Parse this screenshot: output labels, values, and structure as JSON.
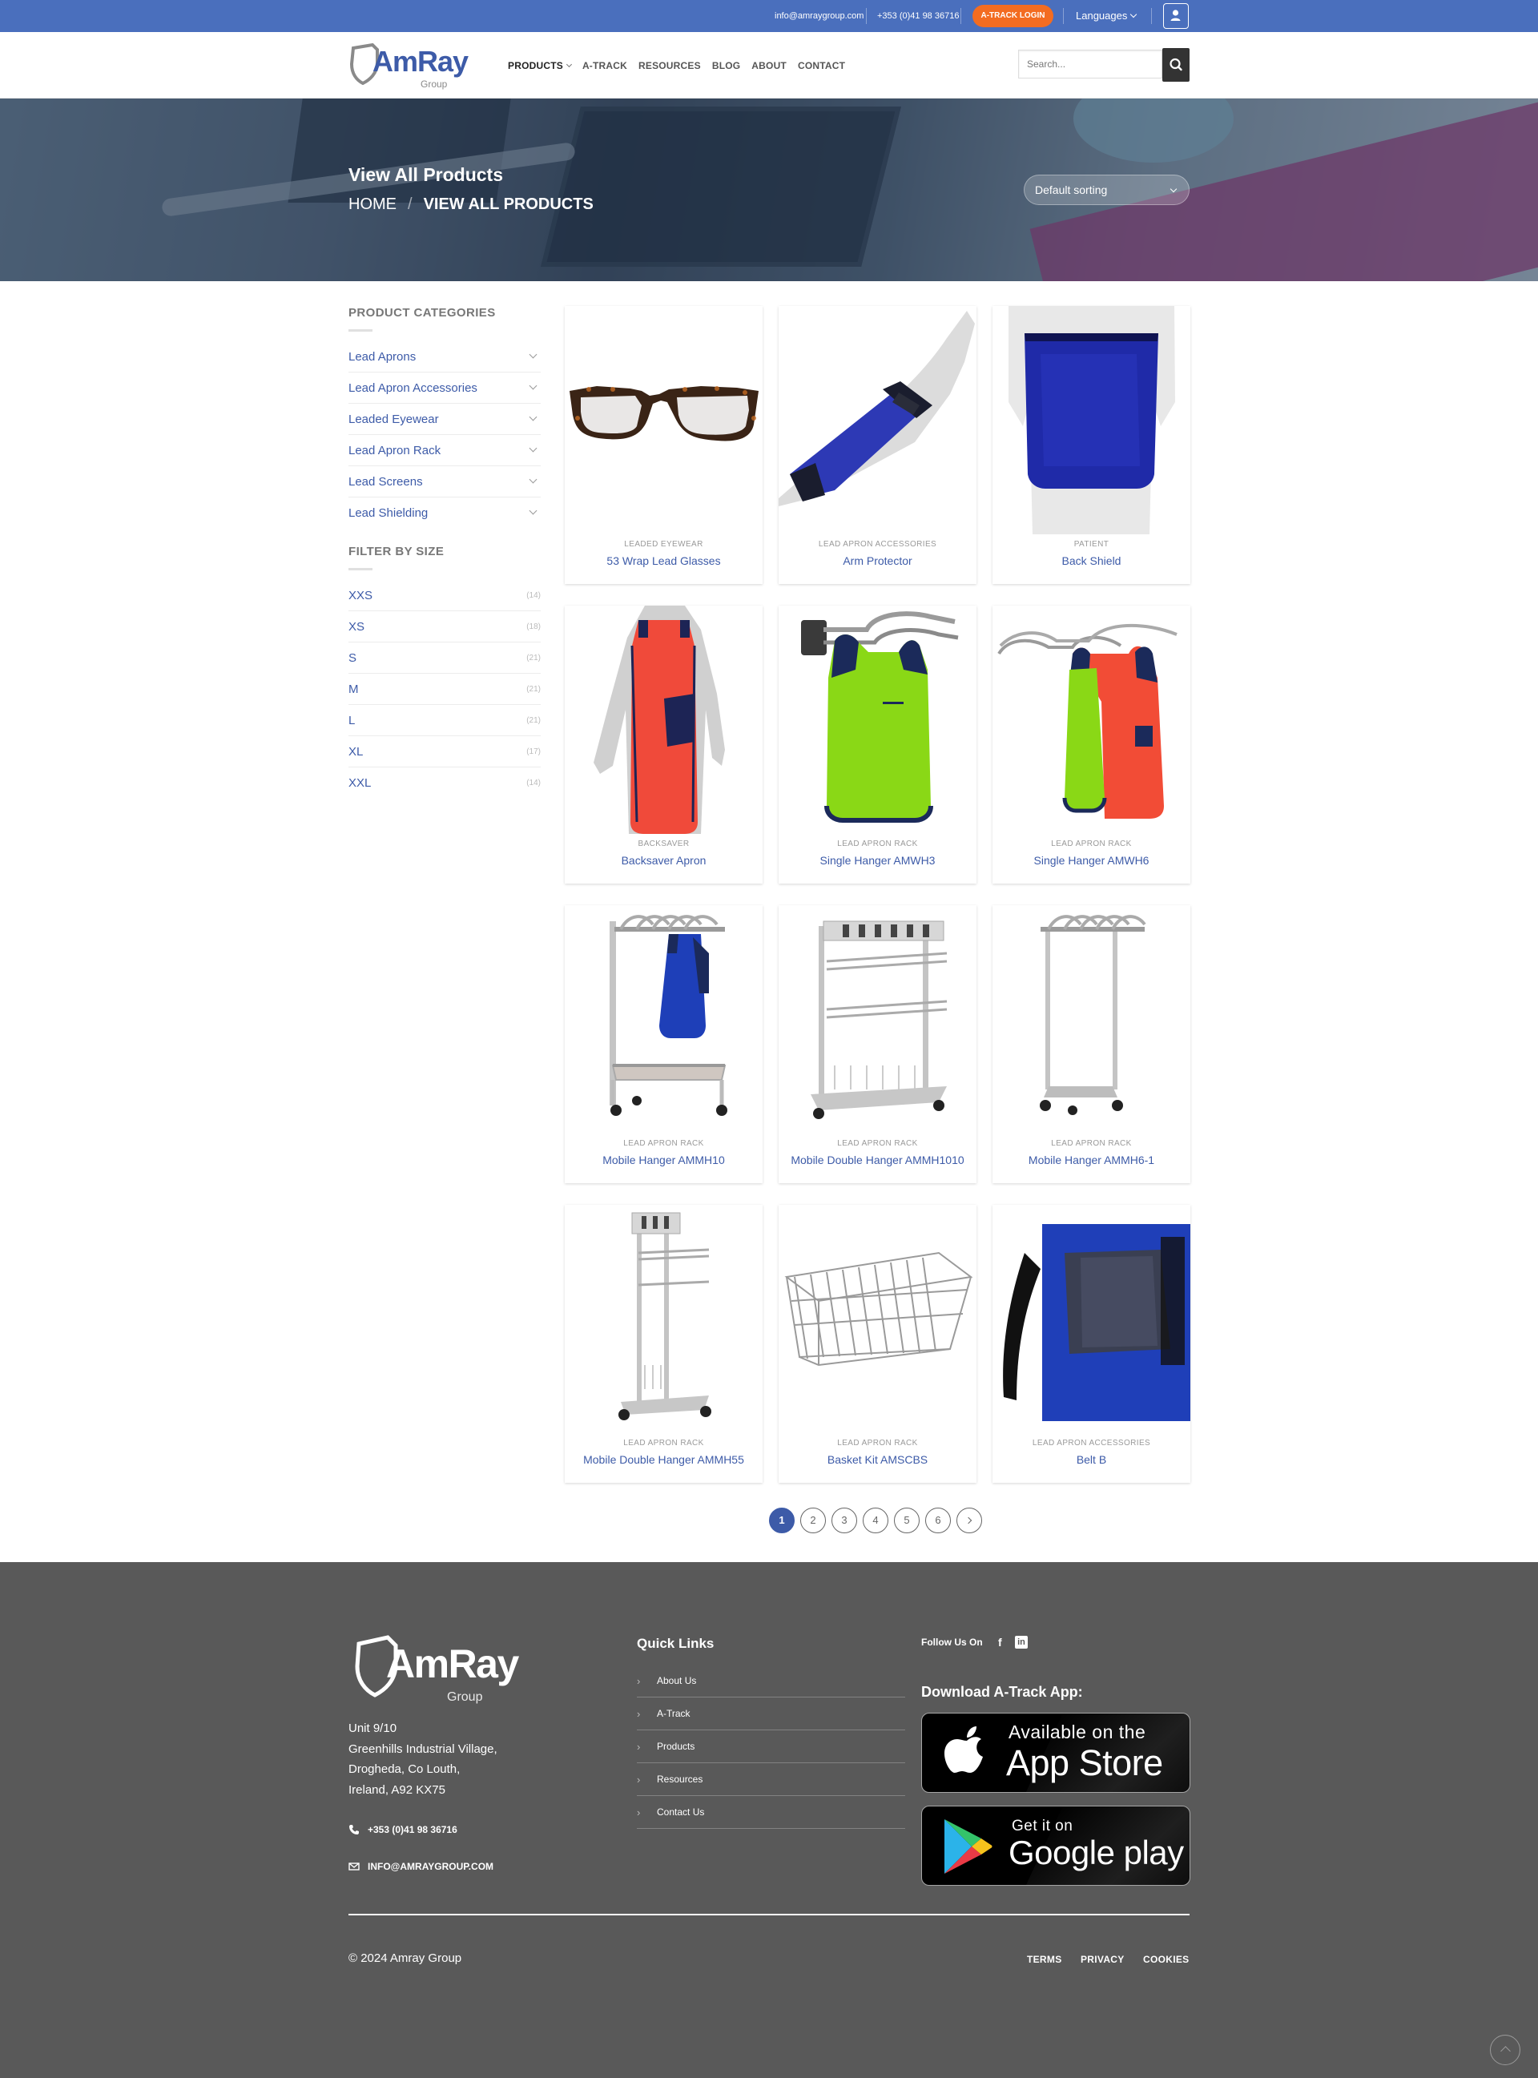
{
  "topbar": {
    "email": "info@amraygroup.com",
    "phone": "+353 (0)41 98 36716",
    "login_label": "A-TRACK LOGIN",
    "languages_label": "Languages",
    "color": "#4a6fbd",
    "login_color": "#f36c21"
  },
  "header": {
    "logo_brand": "AmRay",
    "logo_sub": "Group",
    "nav": [
      "PRODUCTS",
      "A-TRACK",
      "RESOURCES",
      "BLOG",
      "ABOUT",
      "CONTACT"
    ],
    "search_placeholder": "Search..."
  },
  "hero": {
    "title": "View All Products",
    "breadcrumb_home": "HOME",
    "breadcrumb_sep": "/",
    "breadcrumb_current": "VIEW ALL PRODUCTS",
    "sort_label": "Default sorting"
  },
  "sidebar": {
    "categories_heading": "PRODUCT CATEGORIES",
    "categories": [
      "Lead Aprons",
      "Lead Apron Accessories",
      "Leaded Eyewear",
      "Lead Apron Rack",
      "Lead Screens",
      "Lead Shielding"
    ],
    "size_heading": "FILTER BY SIZE",
    "sizes": [
      {
        "label": "XXS",
        "count": "(14)"
      },
      {
        "label": "XS",
        "count": "(18)"
      },
      {
        "label": "S",
        "count": "(21)"
      },
      {
        "label": "M",
        "count": "(21)"
      },
      {
        "label": "L",
        "count": "(21)"
      },
      {
        "label": "XL",
        "count": "(17)"
      },
      {
        "label": "XXL",
        "count": "(14)"
      }
    ]
  },
  "products": [
    {
      "category": "LEADED EYEWEAR",
      "name": "53 Wrap Lead Glasses",
      "image": "glasses"
    },
    {
      "category": "LEAD APRON ACCESSORIES",
      "name": "Arm Protector",
      "image": "arm"
    },
    {
      "category": "PATIENT",
      "name": "Back Shield",
      "image": "backshield"
    },
    {
      "category": "BACKSAVER",
      "name": "Backsaver Apron",
      "image": "backsaver"
    },
    {
      "category": "LEAD APRON RACK",
      "name": "Single Hanger AMWH3",
      "image": "wallhanger-green"
    },
    {
      "category": "LEAD APRON RACK",
      "name": "Single Hanger AMWH6",
      "image": "wallhanger-multi"
    },
    {
      "category": "LEAD APRON RACK",
      "name": "Mobile Hanger AMMH10",
      "image": "mobile-blue"
    },
    {
      "category": "LEAD APRON RACK",
      "name": "Mobile Double Hanger AMMH1010",
      "image": "mobile-double"
    },
    {
      "category": "LEAD APRON RACK",
      "name": "Mobile Hanger AMMH6-1",
      "image": "mobile-plain"
    },
    {
      "category": "LEAD APRON RACK",
      "name": "Mobile Double Hanger AMMH55",
      "image": "mobile-double-slim"
    },
    {
      "category": "LEAD APRON RACK",
      "name": "Basket Kit AMSCBS",
      "image": "basket"
    },
    {
      "category": "LEAD APRON ACCESSORIES",
      "name": "Belt B",
      "image": "belt"
    }
  ],
  "pagination": {
    "pages": [
      "1",
      "2",
      "3",
      "4",
      "5",
      "6"
    ],
    "current": "1"
  },
  "footer": {
    "logo_brand": "AmRay",
    "logo_sub": "Group",
    "address": [
      "Unit 9/10",
      "Greenhills Industrial Village,",
      "Drogheda, Co Louth,",
      "Ireland, A92 KX75"
    ],
    "phone": "+353 (0)41 98 36716",
    "email": "INFO@AMRAYGROUP.COM",
    "quick_links_heading": "Quick Links",
    "quick_links": [
      "About Us",
      "A-Track",
      "Products",
      "Resources",
      "Contact Us"
    ],
    "follow_label": "Follow Us On",
    "download_heading": "Download A-Track App:",
    "appstore_line1": "Available on the",
    "appstore_line2": "App Store",
    "google_line1": "Get it on",
    "google_line2": "Google play",
    "copyright": "© 2024 Amray Group",
    "legal": [
      "TERMS",
      "PRIVACY",
      "COOKIES"
    ]
  }
}
